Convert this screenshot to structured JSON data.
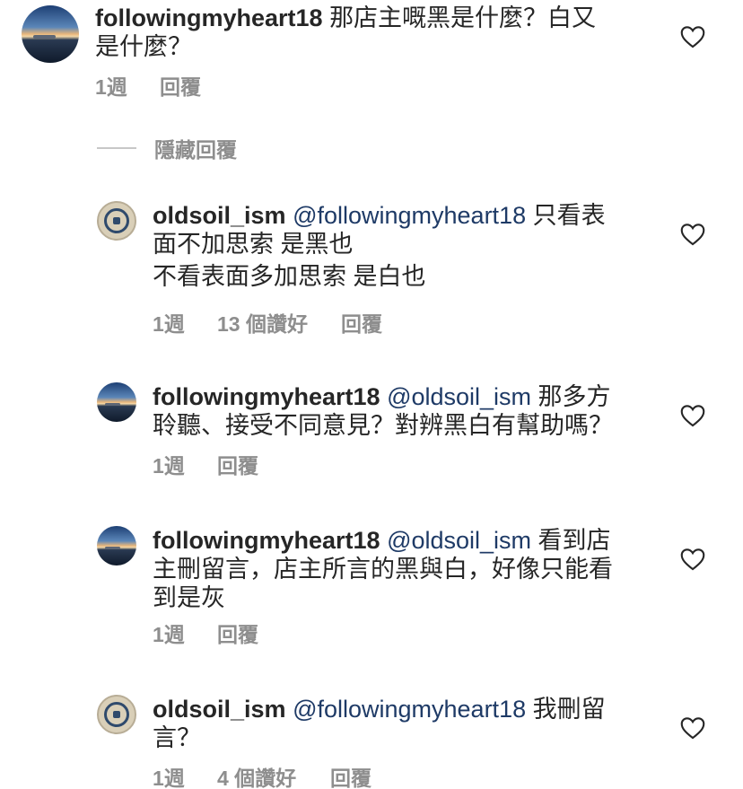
{
  "comments": [
    {
      "username": "followingmyheart18",
      "mention": "",
      "text_line1": "那店主嘅黑是什麼？白又",
      "text_line2": "是什麼？",
      "time": "1週",
      "likes": "",
      "reply": "回覆",
      "avatar": "sunset-avatar"
    },
    {
      "username": "oldsoil_ism",
      "mention": "@followingmyheart18",
      "text_line1": "只看表",
      "text_line2": "面不加思索 是黑也",
      "text_line3": "不看表面多加思索 是白也",
      "time": "1週",
      "likes": "13 個讚好",
      "reply": "回覆",
      "avatar": "seal-avatar"
    },
    {
      "username": "followingmyheart18",
      "mention": "@oldsoil_ism",
      "text_line1": "那多方",
      "text_line2": "聆聽、接受不同意見？對辨黑白有幫助嗎？",
      "time": "1週",
      "likes": "",
      "reply": "回覆",
      "avatar": "sunset-avatar"
    },
    {
      "username": "followingmyheart18",
      "mention": "@oldsoil_ism",
      "text_line1": "看到店",
      "text_line2": "主刪留言，店主所言的黑與白，好像只能看",
      "text_line3": "到是灰",
      "time": "1週",
      "likes": "",
      "reply": "回覆",
      "avatar": "sunset-avatar"
    },
    {
      "username": "oldsoil_ism",
      "mention": "@followingmyheart18",
      "text_line1": "我刪留",
      "text_line2": "言？",
      "time": "1週",
      "likes": "4 個讚好",
      "reply": "回覆",
      "avatar": "seal-avatar"
    }
  ],
  "hide_replies_label": "隱藏回覆",
  "icons": {
    "like": "heart-icon"
  },
  "colors": {
    "text": "#262626",
    "meta": "#8e8e8e",
    "mention": "#1e3a66"
  }
}
